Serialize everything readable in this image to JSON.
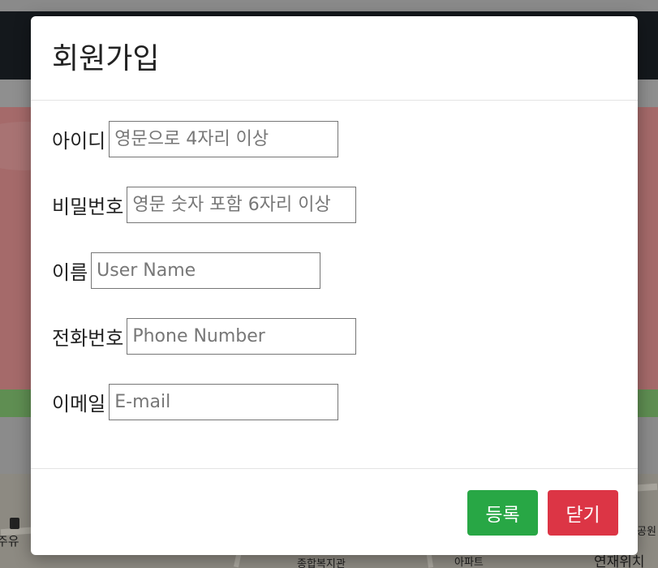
{
  "background": {
    "map_labels": [
      "종합복지관",
      "아파트",
      "연재위치",
      "주유",
      "공원"
    ]
  },
  "modal": {
    "title": "회원가입",
    "fields": [
      {
        "label": "아이디",
        "placeholder": "영문으로 4자리 이상"
      },
      {
        "label": "비밀번호",
        "placeholder": "영문 숫자 포함 6자리 이상"
      },
      {
        "label": "이름",
        "placeholder": "User Name"
      },
      {
        "label": "전화번호",
        "placeholder": "Phone Number"
      },
      {
        "label": "이메일",
        "placeholder": "E-mail"
      }
    ],
    "buttons": {
      "register": "등록",
      "close": "닫기"
    }
  },
  "colors": {
    "register_button": "#28a745",
    "close_button": "#dc3545"
  }
}
